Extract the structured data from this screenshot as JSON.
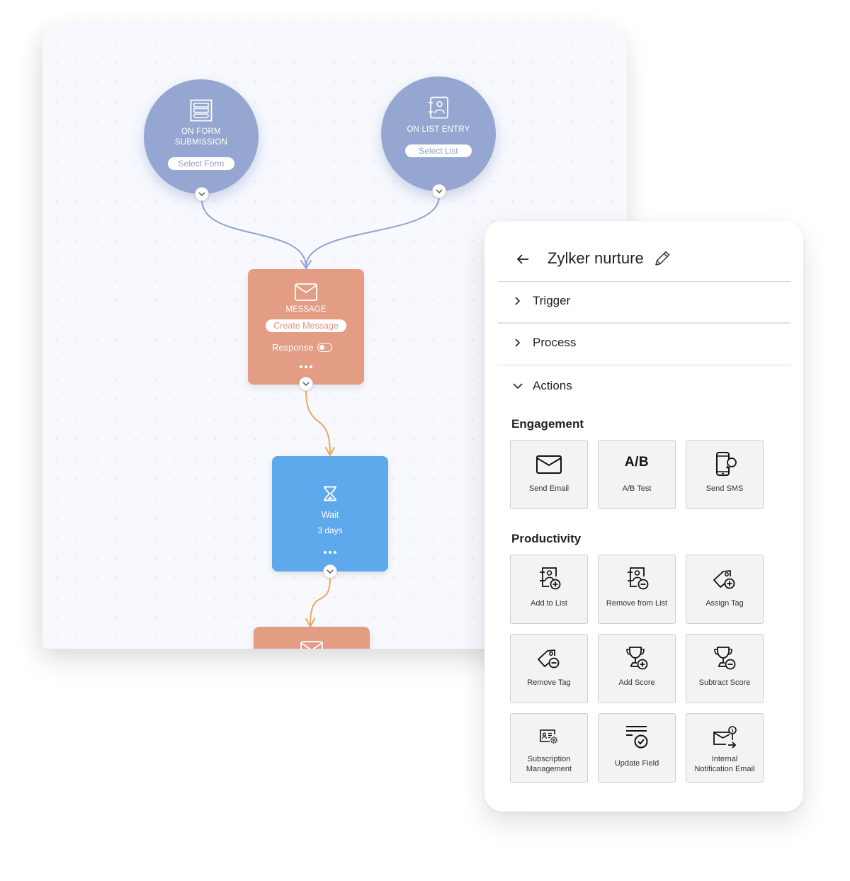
{
  "canvas": {
    "triggers": [
      {
        "title_lines": [
          "ON FORM",
          "SUBMISSION"
        ],
        "button": "Select Form",
        "icon": "form-icon"
      },
      {
        "title_lines": [
          "ON LIST ENTRY"
        ],
        "button": "Select List",
        "icon": "contact-list-icon"
      }
    ],
    "message_node": {
      "title": "MESSAGE",
      "button": "Create Message",
      "response_label": "Response",
      "response_enabled": false,
      "icon": "envelope-icon"
    },
    "wait_node": {
      "title": "Wait",
      "duration": "3 days",
      "icon": "hourglass-icon"
    },
    "next_node": {
      "icon": "envelope-icon"
    },
    "colors": {
      "trigger": "#95a6d1",
      "message": "#e29d84",
      "wait": "#5ea8ec",
      "connector_trigger": "#8fa3d3",
      "connector_flow": "#eda85d"
    }
  },
  "panel": {
    "title": "Zylker nurture",
    "accordions": [
      {
        "label": "Trigger",
        "expanded": false
      },
      {
        "label": "Process",
        "expanded": false
      },
      {
        "label": "Actions",
        "expanded": true
      }
    ],
    "sections": [
      {
        "title": "Engagement",
        "items": [
          {
            "label": "Send Email",
            "icon": "envelope-icon"
          },
          {
            "label": "A/B Test",
            "icon": "ab-test-icon",
            "glyph": "A/B"
          },
          {
            "label": "Send SMS",
            "icon": "phone-chat-icon"
          }
        ]
      },
      {
        "title": "Productivity",
        "items": [
          {
            "label": "Add to List",
            "icon": "list-add-icon"
          },
          {
            "label": "Remove from List",
            "icon": "list-remove-icon"
          },
          {
            "label": "Assign Tag",
            "icon": "tag-add-icon"
          },
          {
            "label": "Remove Tag",
            "icon": "tag-remove-icon"
          },
          {
            "label": "Add Score",
            "icon": "trophy-add-icon"
          },
          {
            "label": "Subtract Score",
            "icon": "trophy-remove-icon"
          },
          {
            "label": "Subscription Management",
            "label_lines": [
              "Subscription",
              "Management"
            ],
            "icon": "subscription-settings-icon"
          },
          {
            "label": "Update Field",
            "icon": "update-field-icon"
          },
          {
            "label": "Internal Notification Email",
            "label_lines": [
              "Internal",
              "Notification Email"
            ],
            "icon": "notification-email-icon",
            "badge": "1"
          }
        ]
      }
    ]
  }
}
